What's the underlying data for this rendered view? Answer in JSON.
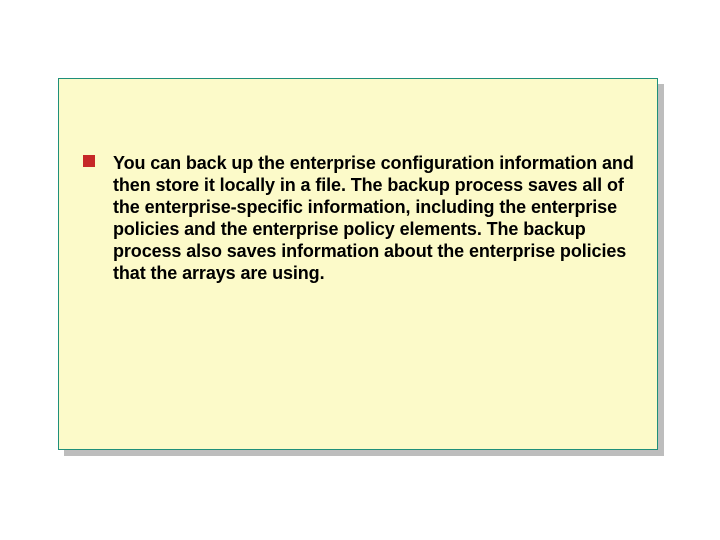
{
  "colors": {
    "panel_bg": "#fcfac9",
    "panel_border": "#1f8f7a",
    "shadow": "#bdbdbd",
    "bullet": "#c62828",
    "text": "#000000"
  },
  "slide": {
    "bullets": [
      {
        "text": "You can back up the enterprise configuration information and then store it locally in a file. The backup process saves all of the enterprise-specific information, including the enterprise policies and the enterprise policy elements. The backup process also saves information about the enterprise policies that the arrays are using."
      }
    ]
  }
}
